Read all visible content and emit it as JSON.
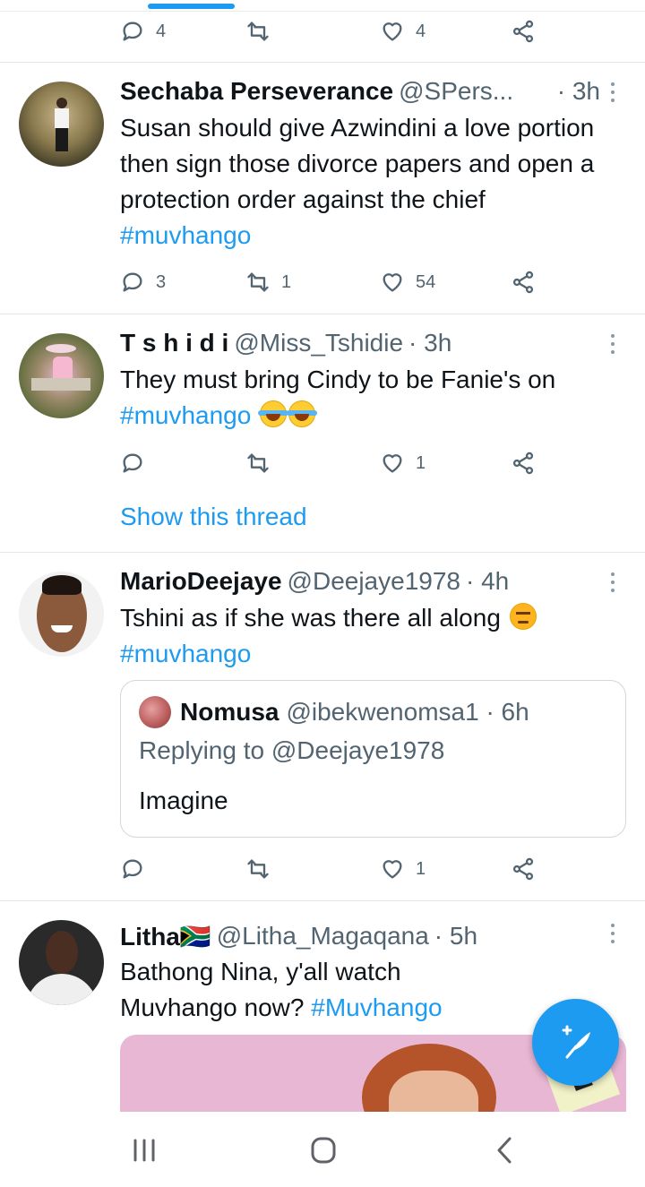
{
  "colors": {
    "accent": "#1d9bf0",
    "text": "#0f1419",
    "muted": "#536471"
  },
  "top_actions": {
    "reply_count": "4",
    "retweet_count": "",
    "like_count": "4"
  },
  "tweets": [
    {
      "name": "Sechaba Perseverance",
      "handle": "@SPers...",
      "time": "· 3h",
      "text": "Susan should give Azwindini a love portion then sign those divorce papers and open a protection order against the chief",
      "hashtag": "#muvhango",
      "reply_count": "3",
      "retweet_count": "1",
      "like_count": "54"
    },
    {
      "name": "T s h i d i",
      "handle": "@Miss_Tshidie",
      "time": "· 3h",
      "text": "They must bring Cindy to be Fanie's on",
      "hashtag": "#muvhango",
      "emoji": "😂😂",
      "reply_count": "",
      "retweet_count": "",
      "like_count": "1",
      "show_thread": "Show this thread"
    },
    {
      "name": "MarioDeejaye",
      "handle": "@Deejaye1978",
      "time": "· 4h",
      "text": "Tshini as if she was there all along",
      "emoji": "😠",
      "hashtag": "#muvhango",
      "quote": {
        "name": "Nomusa",
        "handle": "@ibekwenomsa1 · 6h",
        "replying": "Replying to @Deejaye1978",
        "text": "Imagine"
      },
      "reply_count": "",
      "retweet_count": "",
      "like_count": "1"
    },
    {
      "name": "Litha🇿🇦",
      "handle": "@Litha_Magaqana",
      "time": "· 5h",
      "text": "Bathong Nina, y'all watch Muvhango now?",
      "hashtag": "#Muvhango"
    }
  ],
  "icons": {
    "reply": "reply-icon",
    "retweet": "retweet-icon",
    "like": "heart-icon",
    "share": "share-icon",
    "compose": "compose-tweet-icon",
    "nav_recents": "recent-apps-icon",
    "nav_home": "home-icon",
    "nav_back": "back-icon"
  }
}
